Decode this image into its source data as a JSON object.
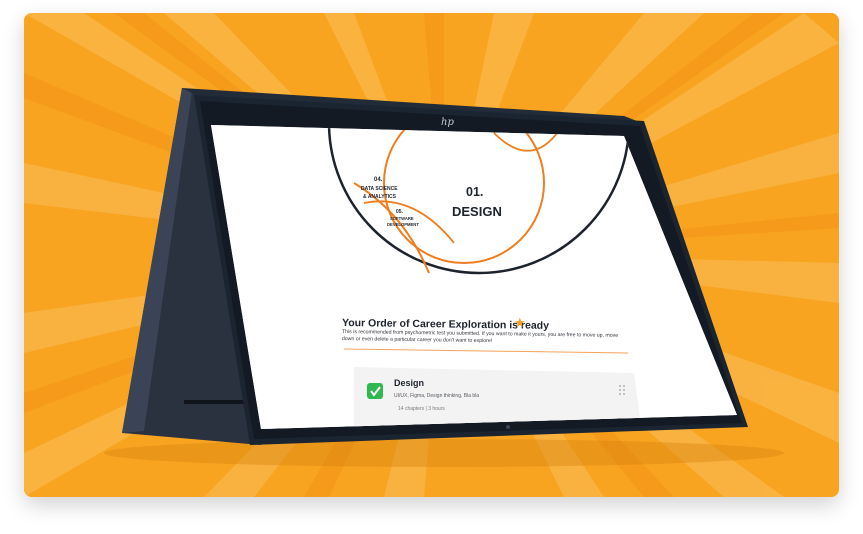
{
  "wheel": {
    "center_number": "01.",
    "center_label": "DESIGN",
    "segment_04_number": "04.",
    "segment_04_label_line1": "DATA SCIENCE",
    "segment_04_label_line2": "& ANALYTICS",
    "segment_05_number": "05.",
    "segment_05_label_line1": "SOFTWARE",
    "segment_05_label_line2": "DEVELOPMENT"
  },
  "ready": {
    "title": "Your Order of Career Exploration is ready",
    "description": "This is recommended from psychometric test you submitted. If you want to make it yours, you are free to move up, move down or even delete a particular career you don't want to explore!"
  },
  "course": {
    "name": "Design",
    "tags": "UI/UX, Figma, Design thinking, Bla bla",
    "meta": "14 chapters | 3 hours"
  },
  "brand": {
    "logo_text": "hp"
  },
  "colors": {
    "background": "#f7a21c",
    "accent": "#f07d1e",
    "check": "#2fb750",
    "bezel": "#1b2431"
  },
  "icons": {
    "star": "star-icon",
    "check": "check-icon",
    "drag": "drag-handle-icon"
  }
}
